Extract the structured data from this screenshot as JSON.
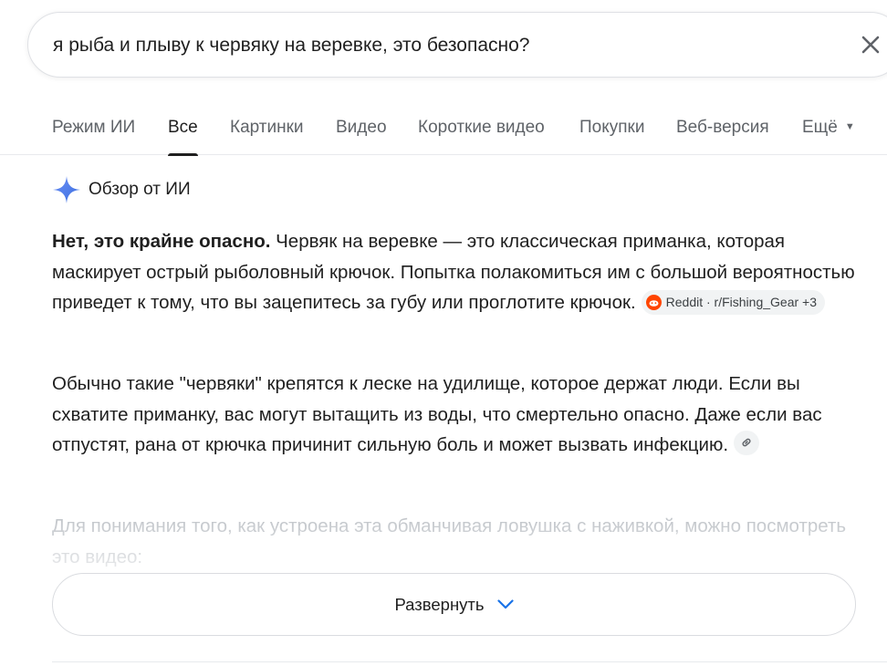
{
  "search": {
    "query": "я рыба и плыву к червяку на веревке, это безопасно?",
    "clear_icon": "close-icon"
  },
  "tabs": [
    {
      "label": "Режим ИИ",
      "active": false
    },
    {
      "label": "Все",
      "active": true
    },
    {
      "label": "Картинки",
      "active": false
    },
    {
      "label": "Видео",
      "active": false
    },
    {
      "label": "Короткие видео",
      "active": false
    },
    {
      "label": "Покупки",
      "active": false
    },
    {
      "label": "Веб-версия",
      "active": false
    },
    {
      "label": "Ещё",
      "active": false
    }
  ],
  "ai_overview": {
    "icon": "sparkle-icon",
    "title": "Обзор от ИИ",
    "p1_bold": "Нет, это крайне опасно.",
    "p1_text": " Червяк на веревке — это классическая приманка, которая маскирует острый рыболовный крючок. Попытка полакомиться им с большой вероятностью приведет к тому, что вы зацепитесь за губу или проглотите крючок.",
    "p1_source": "Reddit · r/Fishing_Gear +3",
    "p2_text": "Обычно такие \"червяки\" крепятся к леске на удилище, которое держат люди. Если вы схватите приманку, вас могут вытащить из воды, что смертельно опасно. Даже если вас отпустят, рана от крючка причинит сильную боль и может вызвать инфекцию.",
    "p3_text": "Для понимания того, как устроена эта обманчивая ловушка с наживкой, можно посмотреть это видео:",
    "expand_label": "Развернуть"
  },
  "colors": {
    "accent_blue": "#4285f4",
    "reddit_orange": "#ff4500",
    "muted_text": "#5f6368"
  }
}
